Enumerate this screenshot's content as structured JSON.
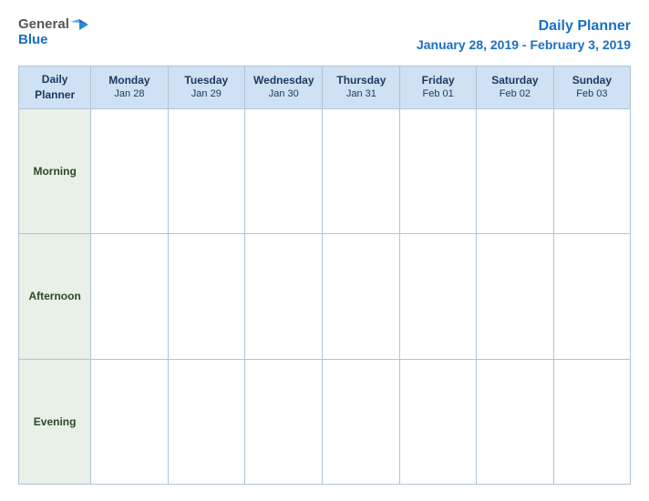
{
  "header": {
    "logo": {
      "general": "General",
      "blue": "Blue"
    },
    "title": "Daily Planner",
    "date_range": "January 28, 2019 - February 3, 2019"
  },
  "table": {
    "header_row": {
      "col0": {
        "line1": "Daily",
        "line2": "Planner"
      },
      "col1": {
        "day": "Monday",
        "date": "Jan 28"
      },
      "col2": {
        "day": "Tuesday",
        "date": "Jan 29"
      },
      "col3": {
        "day": "Wednesday",
        "date": "Jan 30"
      },
      "col4": {
        "day": "Thursday",
        "date": "Jan 31"
      },
      "col5": {
        "day": "Friday",
        "date": "Feb 01"
      },
      "col6": {
        "day": "Saturday",
        "date": "Feb 02"
      },
      "col7": {
        "day": "Sunday",
        "date": "Feb 03"
      }
    },
    "rows": [
      {
        "label": "Morning"
      },
      {
        "label": "Afternoon"
      },
      {
        "label": "Evening"
      }
    ]
  }
}
